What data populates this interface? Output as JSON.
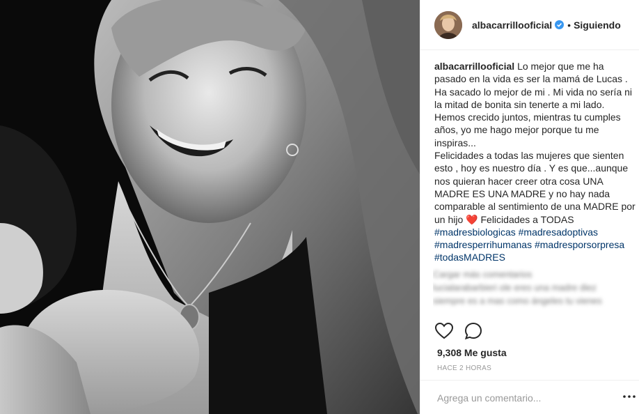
{
  "header": {
    "username": "albacarrillooficial",
    "separator": "•",
    "follow_label": "Siguiendo"
  },
  "caption": {
    "username": "albacarrillooficial",
    "text_1": "Lo mejor que me ha pasado en la vida es ser la mamá de Lucas . Ha sacado lo mejor de mi . Mi vida no sería ni la mitad de bonita sin tenerte a mi lado. Hemos crecido juntos, mientras tu cumples años, yo me hago mejor porque tu me inspiras...",
    "text_2": "Felicidades a todas las mujeres que sienten esto , hoy es nuestro día . Y es que...aunque nos quieran hacer creer otra cosa UNA MADRE ES UNA MADRE y no hay nada comparable al sentimiento de una MADRE por un hijo",
    "heart_emoji": "❤️",
    "text_3": " Felicidades a TODAS",
    "hashtags": [
      "#madresbiologicas",
      "#madresadoptivas",
      "#madresperrihumanas",
      "#madresporsorpresa",
      "#todasMADRES"
    ]
  },
  "blurred_comments": [
    "Cargar más comentarios",
    "lucialarabarbieri ole eres una madre diez",
    "siempre es a mas como ángeles tu vienes"
  ],
  "actions": {
    "like_icon": "heart-outline-icon",
    "comment_icon": "comment-bubble-icon"
  },
  "likes": "9,308 Me gusta",
  "timestamp": "HACE 2 HORAS",
  "comment_box": {
    "placeholder": "Agrega un comentario...",
    "more_icon": "more-options-icon"
  },
  "colors": {
    "text": "#262626",
    "hashtag": "#003569",
    "muted": "#999999",
    "verified": "#3897f0",
    "heart": "#e0245e"
  }
}
